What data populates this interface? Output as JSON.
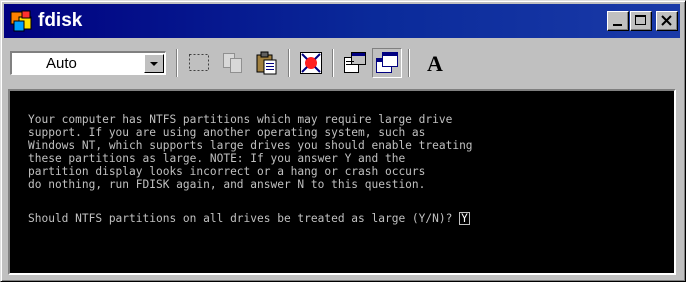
{
  "window": {
    "title": "fdisk",
    "icon": "ms-dos-icon"
  },
  "caption_buttons": {
    "minimize": "minimize-icon",
    "maximize": "maximize-icon",
    "close": "close-icon"
  },
  "toolbar": {
    "font_size_select": {
      "value": "Auto"
    },
    "buttons": [
      {
        "name": "mark-icon"
      },
      {
        "name": "copy-icon"
      },
      {
        "name": "paste-icon"
      },
      {
        "name": "full-screen-icon"
      },
      {
        "name": "properties-icon"
      },
      {
        "name": "background-icon"
      },
      {
        "name": "font-icon",
        "glyph": "A"
      }
    ]
  },
  "console": {
    "message_lines": [
      "Your computer has NTFS partitions which may require large drive",
      "support. If you are using another operating system, such as",
      "Windows NT, which supports large drives you should enable treating",
      "these partitions as large. NOTE: If you answer Y and the",
      "partition display looks incorrect or a hang or crash occurs",
      "do nothing, run FDISK again, and answer N to this question."
    ],
    "prompt": "Should NTFS partitions on all drives be treated as large (Y/N)? ",
    "input_value": "Y"
  },
  "colors": {
    "title_bar": "#000080",
    "console_bg": "#000000",
    "console_text": "#c0c0c0",
    "chrome": "#c0c0c0"
  }
}
